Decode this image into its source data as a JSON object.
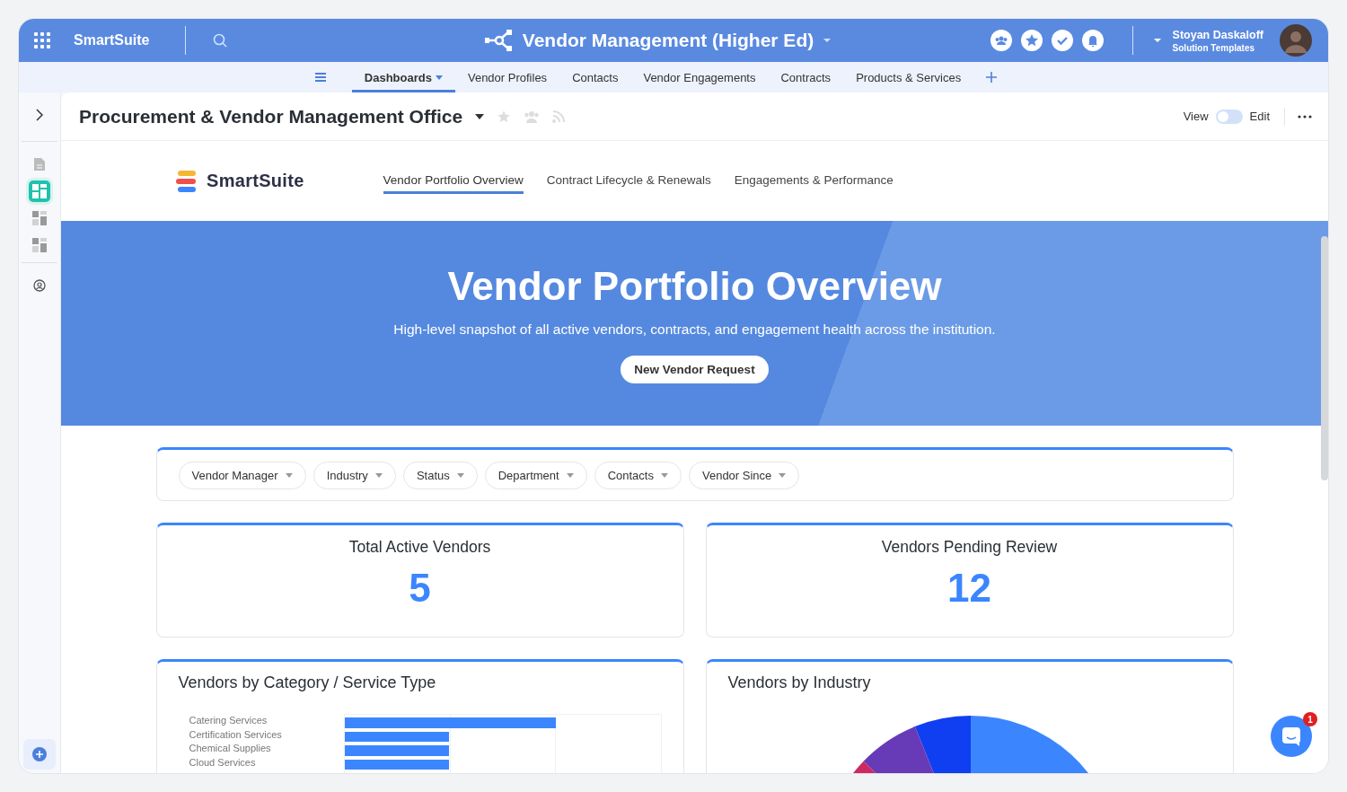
{
  "app": {
    "name": "SmartSuite"
  },
  "solution": {
    "title": "Vendor Management (Higher Ed)"
  },
  "user": {
    "name": "Stoyan Daskaloff",
    "subtitle": "Solution Templates"
  },
  "tabs": [
    {
      "label": "Dashboards",
      "selected": true
    },
    {
      "label": "Vendor Profiles",
      "selected": false
    },
    {
      "label": "Contacts",
      "selected": false
    },
    {
      "label": "Vendor Engagements",
      "selected": false
    },
    {
      "label": "Contracts",
      "selected": false
    },
    {
      "label": "Products & Services",
      "selected": false
    }
  ],
  "sidebar": {
    "items": [
      {
        "selected": true
      },
      {
        "selected": false
      },
      {
        "selected": false
      }
    ]
  },
  "page": {
    "title": "Procurement & Vendor Management Office"
  },
  "mode_toggle": {
    "view_label": "View",
    "edit_label": "Edit",
    "on": false
  },
  "dashboard": {
    "brand": "SmartSuite",
    "tabs": [
      {
        "label": "Vendor Portfolio Overview",
        "selected": true
      },
      {
        "label": "Contract Lifecycle & Renewals",
        "selected": false
      },
      {
        "label": "Engagements & Performance",
        "selected": false
      }
    ],
    "hero": {
      "title": "Vendor Portfolio Overview",
      "subtitle": "High-level snapshot of all active vendors, contracts, and engagement health across the institution.",
      "button": "New Vendor Request"
    },
    "filters": [
      "Vendor Manager",
      "Industry",
      "Status",
      "Department",
      "Contacts",
      "Vendor Since"
    ],
    "metrics": [
      {
        "label": "Total Active Vendors",
        "value": "5"
      },
      {
        "label": "Vendors Pending Review",
        "value": "12"
      }
    ],
    "charts": [
      {
        "title": "Vendors by Category / Service Type",
        "kind": "bars",
        "bars": [
          {
            "label": "Catering Services",
            "level": 0.67
          },
          {
            "label": "Certification Services",
            "level": 0.33
          },
          {
            "label": "Chemical Supplies",
            "level": 0.33
          },
          {
            "label": "Cloud Services",
            "level": 0.33
          }
        ]
      },
      {
        "title": "Vendors by Industry",
        "kind": "pie"
      }
    ]
  },
  "chat": {
    "badge": "1"
  }
}
